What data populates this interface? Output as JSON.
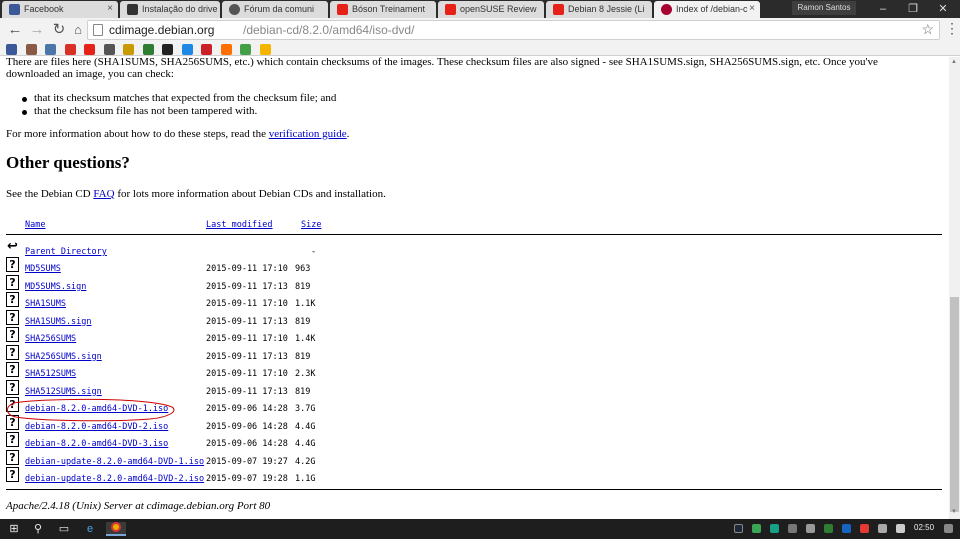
{
  "browser": {
    "tabs": [
      {
        "label": "Facebook",
        "color": "#3b5998"
      },
      {
        "label": "Instalação do drive",
        "color": "#333333"
      },
      {
        "label": "Fórum da comuni",
        "color": "#555555"
      },
      {
        "label": "Bóson Treinament",
        "color": "#e62117"
      },
      {
        "label": "openSUSE Review",
        "color": "#e62117"
      },
      {
        "label": "Debian 8 Jessie (Li",
        "color": "#e62117"
      },
      {
        "label": "Index of /debian-c",
        "color": "#a80030"
      }
    ],
    "profile_name": "Ramon Santos",
    "url_host": "cdimage.debian.org",
    "url_path": "/debian-cd/8.2.0/amd64/iso-dvd/"
  },
  "page": {
    "intro_line1": "There are files here (SHA1SUMS, SHA256SUMS, etc.) which contain checksums of the images. These checksum files are also signed - see SHA1SUMS.sign, SHA256SUMS.sign, etc. Once you've",
    "intro_line2": "downloaded an image, you can check:",
    "bullets": [
      "that its checksum matches that expected from the checksum file; and",
      "that the checksum file has not been tampered with."
    ],
    "more_info_prefix": "For more information about how to do these steps, read the ",
    "more_info_link": "verification guide",
    "more_info_suffix": ".",
    "other_heading": "Other questions?",
    "faq_prefix": "See the Debian CD ",
    "faq_link": "FAQ",
    "faq_suffix": " for lots more information about Debian CDs and installation.",
    "columns": {
      "name": "Name",
      "modified": "Last modified",
      "size": "Size"
    },
    "parent_label": "Parent Directory",
    "parent_size": "-",
    "files": [
      {
        "name": "MD5SUMS",
        "date": "2015-09-11 17:10",
        "size": "963"
      },
      {
        "name": "MD5SUMS.sign",
        "date": "2015-09-11 17:13",
        "size": "819"
      },
      {
        "name": "SHA1SUMS",
        "date": "2015-09-11 17:10",
        "size": "1.1K"
      },
      {
        "name": "SHA1SUMS.sign",
        "date": "2015-09-11 17:13",
        "size": "819"
      },
      {
        "name": "SHA256SUMS",
        "date": "2015-09-11 17:10",
        "size": "1.4K"
      },
      {
        "name": "SHA256SUMS.sign",
        "date": "2015-09-11 17:13",
        "size": "819"
      },
      {
        "name": "SHA512SUMS",
        "date": "2015-09-11 17:10",
        "size": "2.3K"
      },
      {
        "name": "SHA512SUMS.sign",
        "date": "2015-09-11 17:13",
        "size": "819"
      },
      {
        "name": "debian-8.2.0-amd64-DVD-1.iso",
        "date": "2015-09-06 14:28",
        "size": "3.7G"
      },
      {
        "name": "debian-8.2.0-amd64-DVD-2.iso",
        "date": "2015-09-06 14:28",
        "size": "4.4G"
      },
      {
        "name": "debian-8.2.0-amd64-DVD-3.iso",
        "date": "2015-09-06 14:28",
        "size": "4.4G"
      },
      {
        "name": "debian-update-8.2.0-amd64-DVD-1.iso",
        "date": "2015-09-07 19:27",
        "size": "4.2G"
      },
      {
        "name": "debian-update-8.2.0-amd64-DVD-2.iso",
        "date": "2015-09-07 19:28",
        "size": "1.1G"
      }
    ],
    "server_footer": "Apache/2.4.18 (Unix) Server at cdimage.debian.org Port 80"
  },
  "bookmark_icons": [
    {
      "icon": "facebook-icon",
      "color": "#3b5998"
    },
    {
      "icon": "instagram-icon",
      "color": "#8a5a44"
    },
    {
      "icon": "bookmark-icon",
      "color": "#4a76a8"
    },
    {
      "icon": "gmail-icon",
      "color": "#d93025"
    },
    {
      "icon": "youtube-icon",
      "color": "#e62117"
    },
    {
      "icon": "grid-icon",
      "color": "#555555"
    },
    {
      "icon": "shield-icon",
      "color": "#c89a00"
    },
    {
      "icon": "square-icon",
      "color": "#2e7d32"
    },
    {
      "icon": "tux-icon",
      "color": "#222222"
    },
    {
      "icon": "globe-icon",
      "color": "#1e88e5"
    },
    {
      "icon": "pinterest-icon",
      "color": "#cb2027"
    },
    {
      "icon": "orange-icon",
      "color": "#ff6f00"
    },
    {
      "icon": "green-icon",
      "color": "#43a047"
    },
    {
      "icon": "circle-icon",
      "color": "#f4b400"
    }
  ],
  "taskbar": {
    "clock": "02:50"
  },
  "colors": {
    "link": "#0000cc",
    "annotation": "#cc0000"
  }
}
